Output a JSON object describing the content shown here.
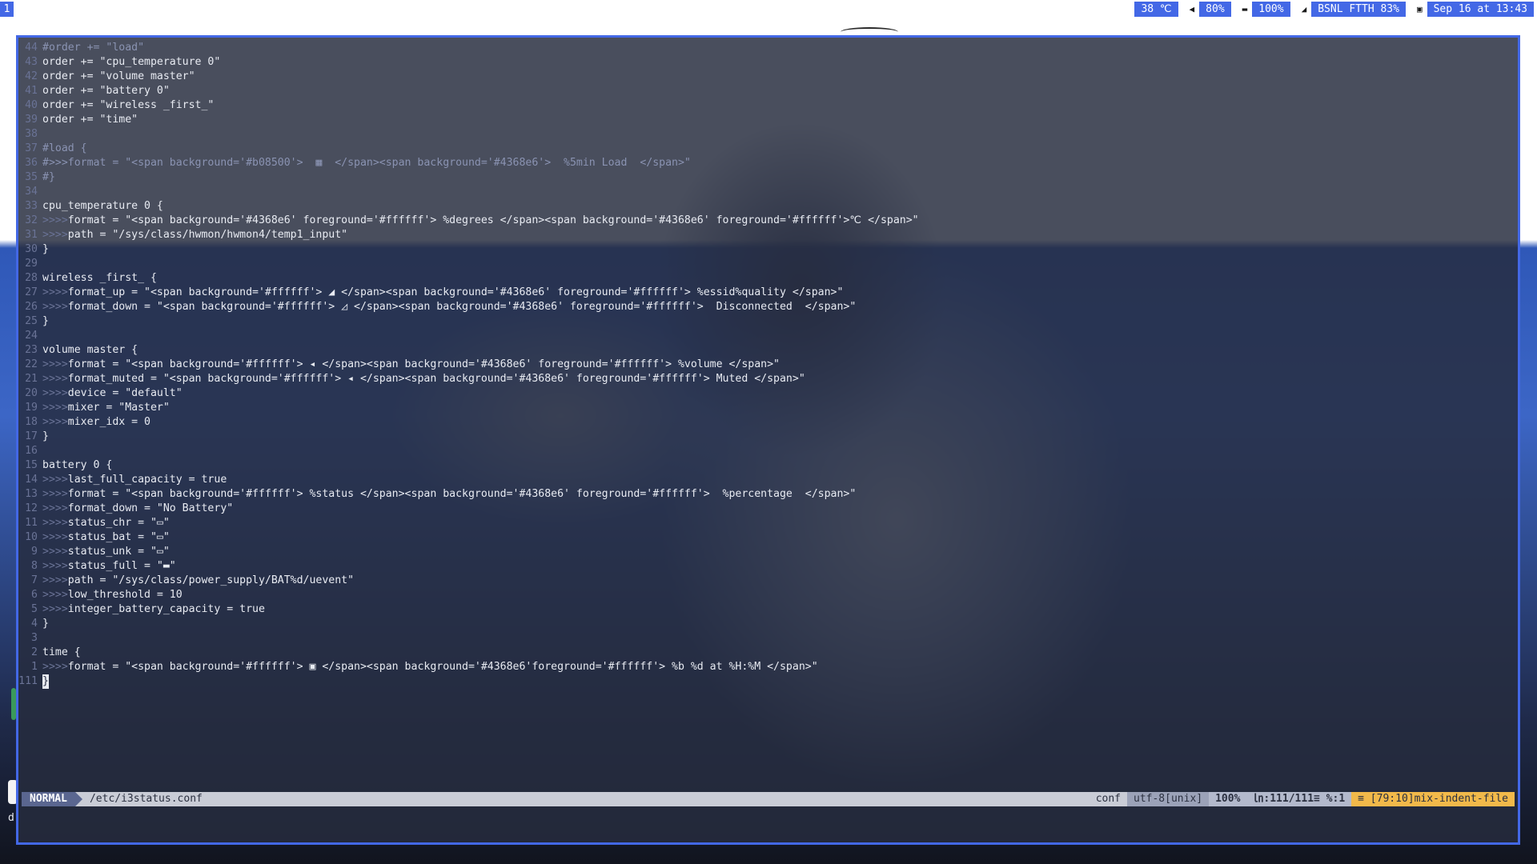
{
  "topbar": {
    "workspace": "1",
    "status": [
      {
        "icon": "thermometer-icon",
        "glyph": "",
        "value": "38 ℃"
      },
      {
        "icon": "volume-icon",
        "glyph": "◀",
        "value": "80%"
      },
      {
        "icon": "battery-icon",
        "glyph": "▬",
        "value": "100%"
      },
      {
        "icon": "wifi-icon",
        "glyph": "◢",
        "value": "BSNL FTTH 83%"
      },
      {
        "icon": "calendar-icon",
        "glyph": "▣",
        "value": "Sep 16 at 13:43"
      }
    ]
  },
  "editor": {
    "lines": [
      {
        "n": "44",
        "ind": "",
        "text": "#order += \"load\"",
        "comment": true
      },
      {
        "n": "43",
        "ind": "",
        "text": "order += \"cpu_temperature 0\""
      },
      {
        "n": "42",
        "ind": "",
        "text": "order += \"volume master\""
      },
      {
        "n": "41",
        "ind": "",
        "text": "order += \"battery 0\""
      },
      {
        "n": "40",
        "ind": "",
        "text": "order += \"wireless _first_\""
      },
      {
        "n": "39",
        "ind": "",
        "text": "order += \"time\""
      },
      {
        "n": "38",
        "ind": "",
        "text": ""
      },
      {
        "n": "37",
        "ind": "",
        "text": "#load {",
        "comment": true
      },
      {
        "n": "36",
        "ind": "",
        "text": "#>>>format = \"<span background='#b08500'>  ▦  </span><span background='#4368e6'>  %5min Load  </span>\"",
        "comment": true
      },
      {
        "n": "35",
        "ind": "",
        "text": "#}",
        "comment": true
      },
      {
        "n": "34",
        "ind": "",
        "text": ""
      },
      {
        "n": "33",
        "ind": "",
        "text": "cpu_temperature 0 {"
      },
      {
        "n": "32",
        "ind": ">>>>",
        "text": "format = \"<span background='#4368e6' foreground='#ffffff'> %degrees </span><span background='#4368e6' foreground='#ffffff'>℃ </span>\""
      },
      {
        "n": "31",
        "ind": ">>>>",
        "text": "path = \"/sys/class/hwmon/hwmon4/temp1_input\""
      },
      {
        "n": "30",
        "ind": "",
        "text": "}"
      },
      {
        "n": "29",
        "ind": "",
        "text": ""
      },
      {
        "n": "28",
        "ind": "",
        "text": "wireless _first_ {"
      },
      {
        "n": "27",
        "ind": ">>>>",
        "text": "format_up = \"<span background='#ffffff'> ◢ </span><span background='#4368e6' foreground='#ffffff'> %essid%quality </span>\""
      },
      {
        "n": "26",
        "ind": ">>>>",
        "text": "format_down = \"<span background='#ffffff'> ◿ </span><span background='#4368e6' foreground='#ffffff'>  Disconnected  </span>\""
      },
      {
        "n": "25",
        "ind": "",
        "text": "}"
      },
      {
        "n": "24",
        "ind": "",
        "text": ""
      },
      {
        "n": "23",
        "ind": "",
        "text": "volume master {"
      },
      {
        "n": "22",
        "ind": ">>>>",
        "text": "format = \"<span background='#ffffff'> ◂ </span><span background='#4368e6' foreground='#ffffff'> %volume </span>\""
      },
      {
        "n": "21",
        "ind": ">>>>",
        "text": "format_muted = \"<span background='#ffffff'> ◂ </span><span background='#4368e6' foreground='#ffffff'> Muted </span>\""
      },
      {
        "n": "20",
        "ind": ">>>>",
        "text": "device = \"default\""
      },
      {
        "n": "19",
        "ind": ">>>>",
        "text": "mixer = \"Master\""
      },
      {
        "n": "18",
        "ind": ">>>>",
        "text": "mixer_idx = 0"
      },
      {
        "n": "17",
        "ind": "",
        "text": "}"
      },
      {
        "n": "16",
        "ind": "",
        "text": ""
      },
      {
        "n": "15",
        "ind": "",
        "text": "battery 0 {"
      },
      {
        "n": "14",
        "ind": ">>>>",
        "text": "last_full_capacity = true"
      },
      {
        "n": "13",
        "ind": ">>>>",
        "text": "format = \"<span background='#ffffff'> %status </span><span background='#4368e6' foreground='#ffffff'>  %percentage  </span>\""
      },
      {
        "n": "12",
        "ind": ">>>>",
        "text": "format_down = \"No Battery\""
      },
      {
        "n": "11",
        "ind": ">>>>",
        "text": "status_chr = \"▭\""
      },
      {
        "n": "10",
        "ind": ">>>>",
        "text": "status_bat = \"▭\""
      },
      {
        "n": "9",
        "ind": ">>>>",
        "text": "status_unk = \"▭\""
      },
      {
        "n": "8",
        "ind": ">>>>",
        "text": "status_full = \"▬\""
      },
      {
        "n": "7",
        "ind": ">>>>",
        "text": "path = \"/sys/class/power_supply/BAT%d/uevent\""
      },
      {
        "n": "6",
        "ind": ">>>>",
        "text": "low_threshold = 10"
      },
      {
        "n": "5",
        "ind": ">>>>",
        "text": "integer_battery_capacity = true"
      },
      {
        "n": "4",
        "ind": "",
        "text": "}"
      },
      {
        "n": "3",
        "ind": "",
        "text": ""
      },
      {
        "n": "2",
        "ind": "",
        "text": "time {"
      },
      {
        "n": "1",
        "ind": ">>>>",
        "text": "format = \"<span background='#ffffff'> ▣ </span><span background='#4368e6'foreground='#ffffff'> %b %d at %H:%M </span>\""
      },
      {
        "n": "111",
        "ind": "",
        "text": "}",
        "cursor": true
      }
    ]
  },
  "statusline": {
    "mode": "NORMAL",
    "file": "/etc/i3status.conf",
    "filetype": "conf",
    "encoding": "utf-8[unix]",
    "percent": "100%",
    "position": "㏑:111/111≡ %:1",
    "warning": "≡ [79:10]mix-indent-file"
  },
  "desktop": {
    "dock_letter": "d"
  }
}
